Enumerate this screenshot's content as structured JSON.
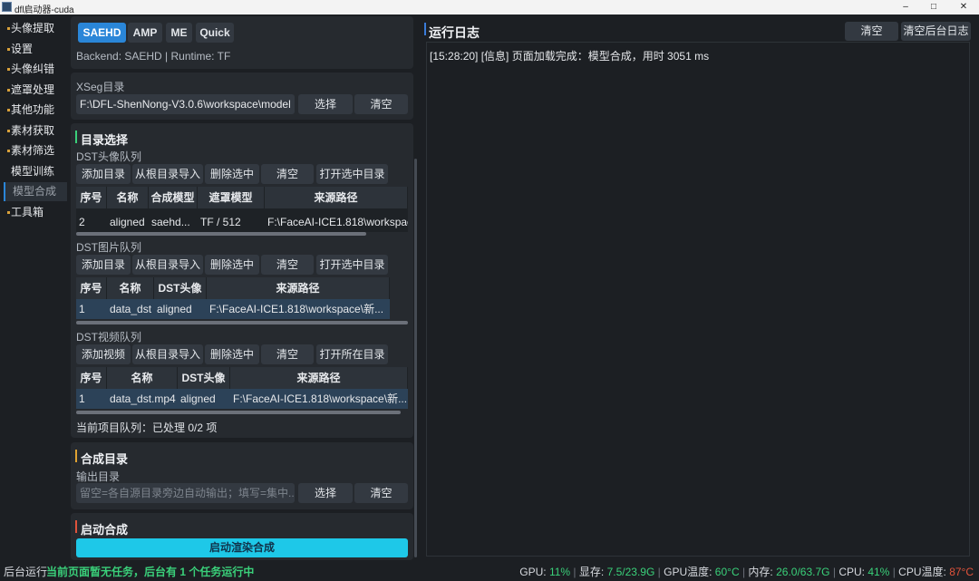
{
  "window": {
    "title": "dfl启动器-cuda",
    "min": "–",
    "max": "□",
    "close": "✕"
  },
  "sidebar": {
    "items": [
      {
        "label": "头像提取"
      },
      {
        "label": "设置"
      },
      {
        "label": "头像纠错"
      },
      {
        "label": "遮罩处理"
      },
      {
        "label": "其他功能"
      },
      {
        "label": "素材获取"
      },
      {
        "label": "素材筛选"
      },
      {
        "label": "模型训练"
      },
      {
        "label": "模型合成"
      },
      {
        "label": "工具箱"
      }
    ]
  },
  "model_tabs": [
    {
      "label": "SAEHD"
    },
    {
      "label": "AMP"
    },
    {
      "label": "ME"
    },
    {
      "label": "Quick"
    }
  ],
  "backend_info": "Backend: SAEHD | Runtime: TF",
  "xseg": {
    "label": "XSeg目录",
    "value": "F:\\DFL-ShenNong-V3.0.6\\workspace\\model",
    "select": "选择",
    "clear": "清空"
  },
  "dir_select": {
    "title": "目录选择",
    "dst_faces": {
      "label": "DST头像队列",
      "buttons": [
        "添加目录",
        "从根目录导入",
        "删除选中",
        "清空",
        "打开选中目录"
      ],
      "columns": [
        "序号",
        "名称",
        "合成模型",
        "遮罩模型",
        "来源路径"
      ],
      "rows": [
        [
          "2",
          "aligned",
          "saehd...",
          "TF / 512",
          "F:\\FaceAI-ICE1.818\\workspace"
        ]
      ]
    },
    "dst_images": {
      "label": "DST图片队列",
      "buttons": [
        "添加目录",
        "从根目录导入",
        "删除选中",
        "清空",
        "打开选中目录"
      ],
      "columns": [
        "序号",
        "名称",
        "DST头像",
        "来源路径"
      ],
      "rows": [
        [
          "1",
          "data_dst",
          "aligned",
          "F:\\FaceAI-ICE1.818\\workspace\\新..."
        ]
      ]
    },
    "dst_videos": {
      "label": "DST视频队列",
      "buttons": [
        "添加视频",
        "从根目录导入",
        "删除选中",
        "清空",
        "打开所在目录"
      ],
      "columns": [
        "序号",
        "名称",
        "DST头像",
        "来源路径"
      ],
      "rows": [
        [
          "1",
          "data_dst.mp4",
          "aligned",
          "F:\\FaceAI-ICE1.818\\workspace\\新..."
        ]
      ]
    },
    "queue_status": "当前项目队列：已处理 0/2 项"
  },
  "merge_dir": {
    "title": "合成目录",
    "output_label": "输出目录",
    "output_placeholder": "留空=各自源目录旁边自动输出；填写=集中...",
    "select": "选择",
    "clear": "清空"
  },
  "start": {
    "title": "启动合成",
    "button": "启动渲染合成"
  },
  "log": {
    "title": "运行日志",
    "clear": "清空",
    "clear_bg": "清空后台日志",
    "lines": [
      "[15:28:20] [信息] 页面加载完成：模型合成，用时 3051 ms"
    ]
  },
  "status_bar": {
    "left_prefix": "后台运行",
    "left_msg": "当前页面暂无任务，后台有 1 个任务运行中",
    "gpu_label": "GPU:",
    "gpu": "11%",
    "vram_label": "显存:",
    "vram": "7.5/23.9G",
    "gpu_temp_label": "GPU温度:",
    "gpu_temp": "60°C",
    "mem_label": "内存:",
    "mem": "26.0/63.7G",
    "cpu_label": "CPU:",
    "cpu": "41%",
    "cpu_temp_label": "CPU温度:",
    "cpu_temp": "87°C"
  },
  "colors": {
    "accent": "#2a86d8",
    "green": "#3ad07a",
    "warn": "#e0533b",
    "cyan": "#1ec8e8"
  }
}
